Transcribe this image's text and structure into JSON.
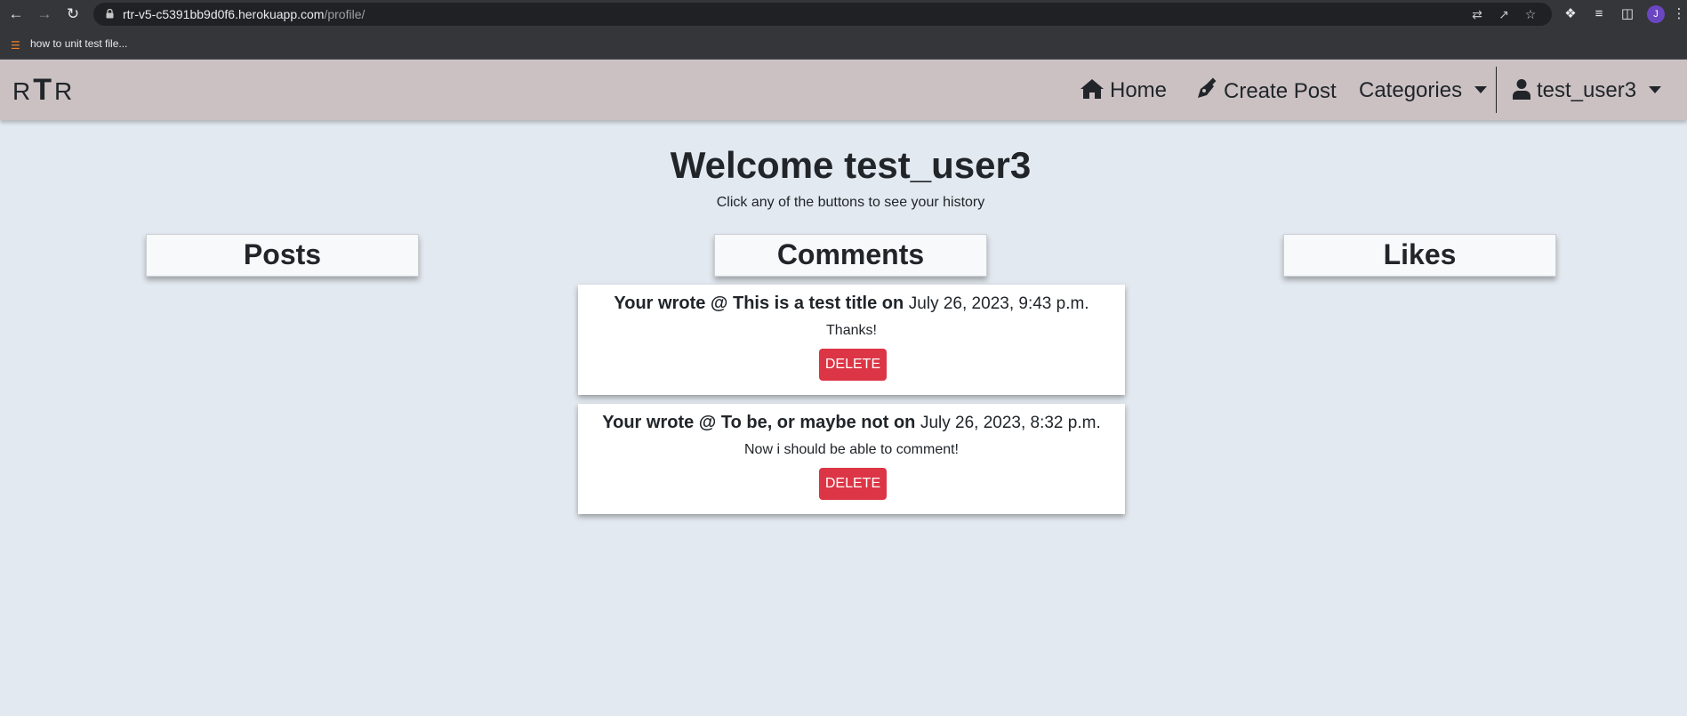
{
  "browser": {
    "url_host": "rtr-v5-c5391bb9d0f6.herokuapp.com",
    "url_path": "/profile/",
    "bookmark_label": "how to unit test file...",
    "profile_initial": "J"
  },
  "navbar": {
    "brand_left": "R",
    "brand_mid": "T",
    "brand_right": "R",
    "home_label": "Home",
    "create_post_label": "Create Post",
    "categories_label": "Categories",
    "user_label": "test_user3"
  },
  "page": {
    "welcome": "Welcome test_user3",
    "subtitle": "Click any of the buttons to see your history"
  },
  "tabs": {
    "posts": "Posts",
    "comments": "Comments",
    "likes": "Likes"
  },
  "comments": [
    {
      "prefix": "Your wrote @ This is a test title on",
      "date": "July 26, 2023, 9:43 p.m.",
      "body": "Thanks!",
      "delete_label": "DELETE"
    },
    {
      "prefix": "Your wrote @ To be, or maybe not on",
      "date": "July 26, 2023, 8:32 p.m.",
      "body": "Now i should be able to comment!",
      "delete_label": "DELETE"
    }
  ],
  "colors": {
    "navbar_bg": "#cbc1c3",
    "page_bg": "#e3e9f0",
    "delete_bg": "#dc3545",
    "profile_avatar": "#6b46c1"
  },
  "icons": [
    "back-icon",
    "forward-icon",
    "reload-icon",
    "lock-icon",
    "translate-icon",
    "share-icon",
    "star-icon",
    "extensions-icon",
    "reading-list-icon",
    "side-panel-icon",
    "menu-icon",
    "stackoverflow-icon",
    "home-icon",
    "pen-icon",
    "user-icon"
  ]
}
